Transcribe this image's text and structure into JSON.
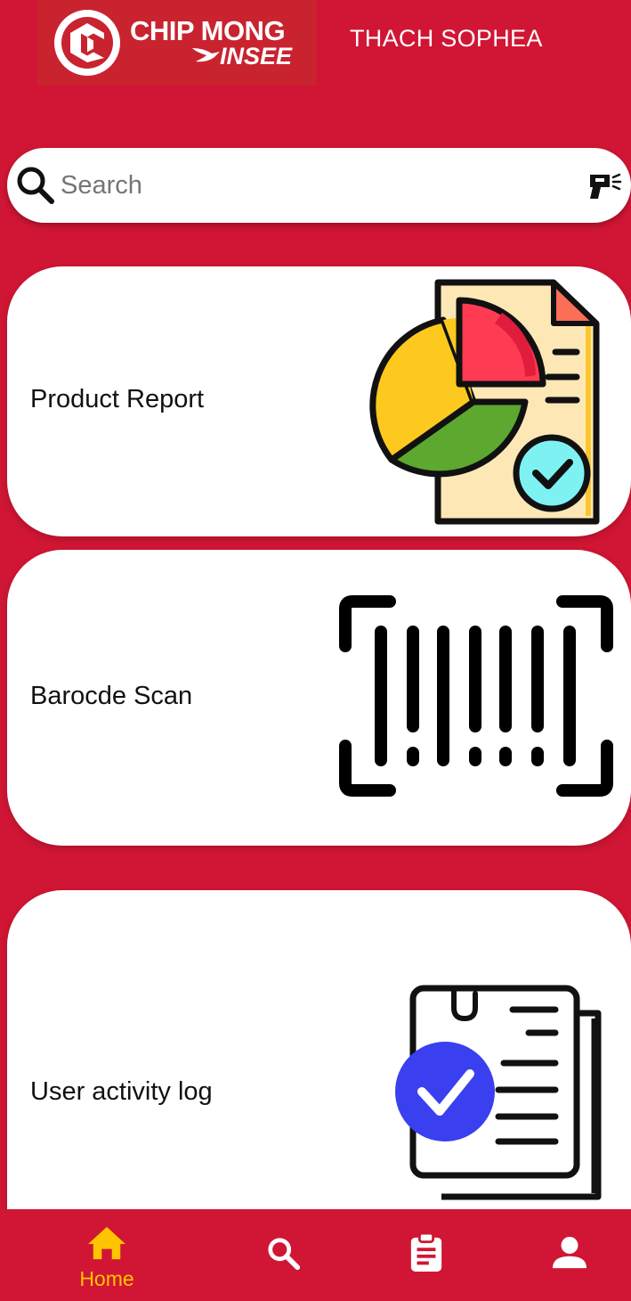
{
  "header": {
    "logo_line1": "CHIP MONG",
    "logo_line2": "INSEE",
    "user_name": "THACH SOPHEA"
  },
  "search": {
    "placeholder": "Search",
    "value": ""
  },
  "cards": [
    {
      "label": "Product Report",
      "icon": "report-chart-icon"
    },
    {
      "label": "Barocde Scan",
      "icon": "barcode-icon"
    },
    {
      "label": "User activity log",
      "icon": "activity-log-icon"
    }
  ],
  "bottom_nav": {
    "items": [
      {
        "label": "Home",
        "icon": "home-icon",
        "active": true
      },
      {
        "label": "",
        "icon": "search-icon",
        "active": false
      },
      {
        "label": "",
        "icon": "clipboard-icon",
        "active": false
      },
      {
        "label": "",
        "icon": "person-icon",
        "active": false
      }
    ]
  },
  "colors": {
    "background": "#d01634",
    "card": "#ffffff",
    "active_nav": "#ffc400",
    "inactive_nav": "#ffffff"
  }
}
